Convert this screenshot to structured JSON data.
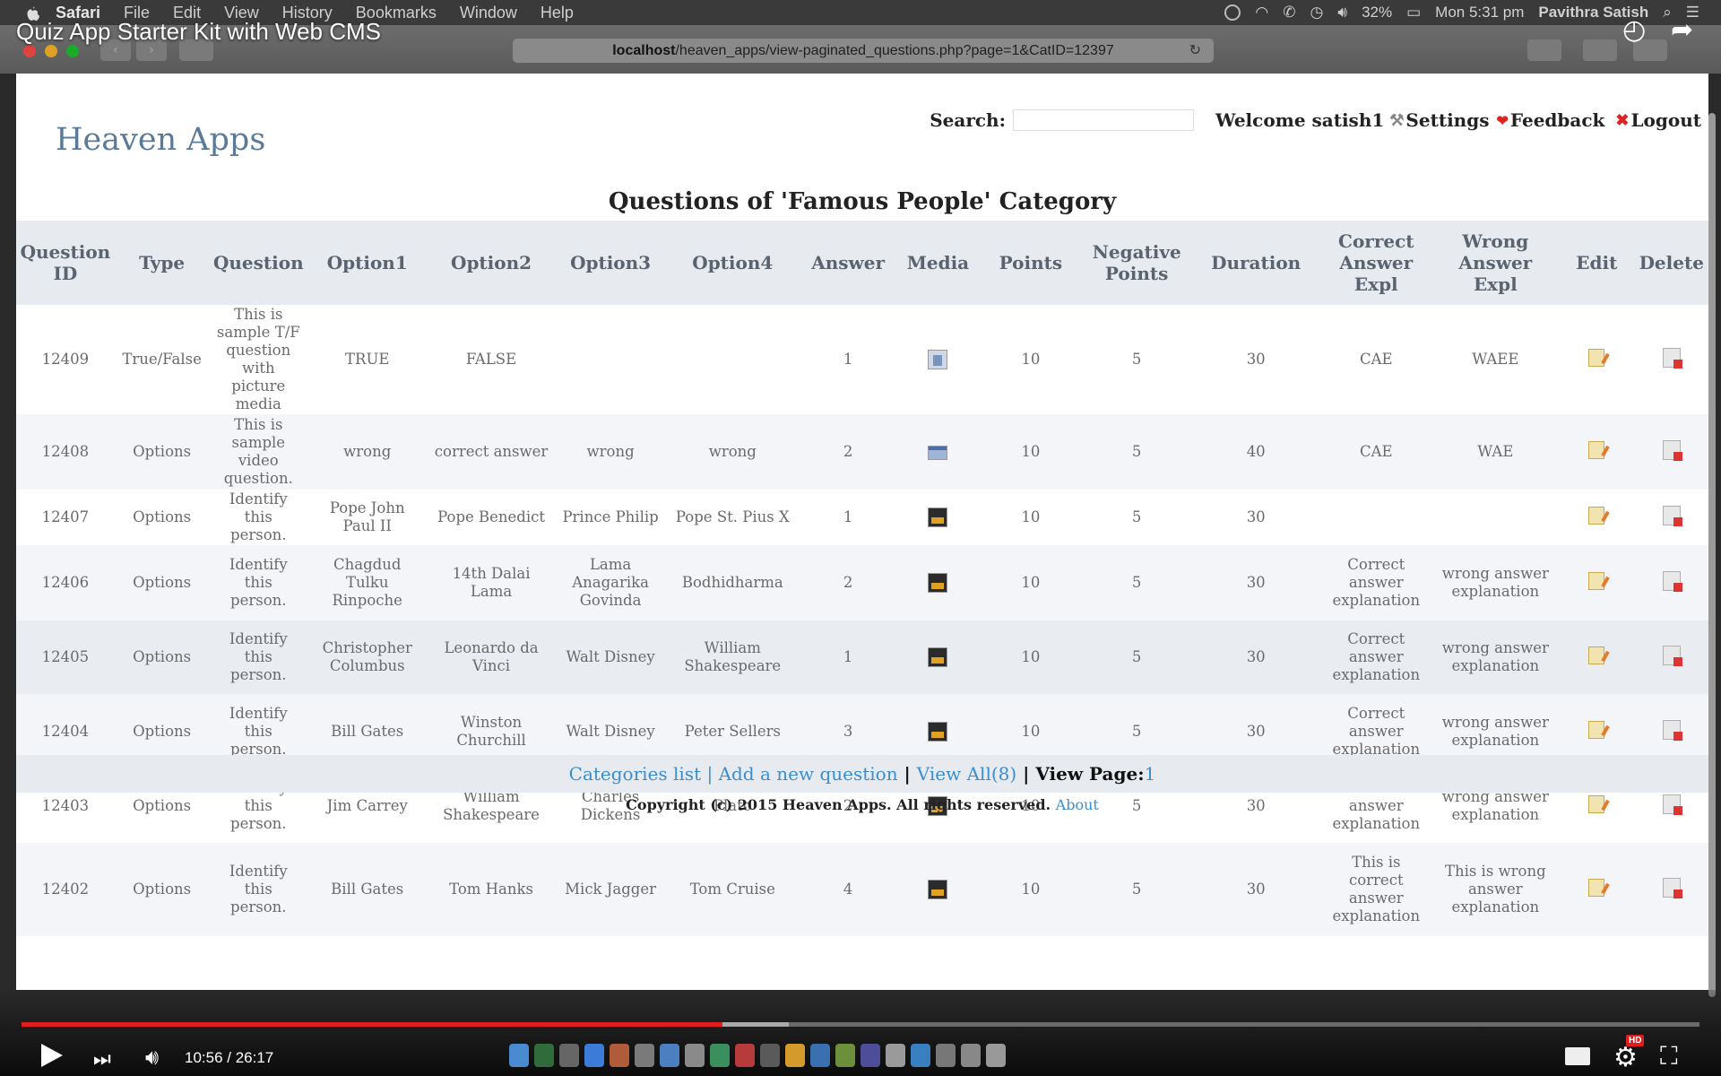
{
  "menubar": {
    "app": "Safari",
    "items": [
      "File",
      "Edit",
      "View",
      "History",
      "Bookmarks",
      "Window",
      "Help"
    ],
    "battery": "32%",
    "clock": "Mon 5:31 pm",
    "user": "Pavithra Satish"
  },
  "browser": {
    "url_host": "localhost",
    "url_path": "/heaven_apps/view-paginated_questions.php?page=1&CatID=12397"
  },
  "video": {
    "title": "Quiz App Starter Kit with Web CMS",
    "time": "10:56 / 26:17",
    "played_fraction": 0.418,
    "buffered_fraction": 0.457,
    "hd": "HD"
  },
  "header": {
    "brand": "Heaven Apps",
    "search_label": "Search:",
    "search_value": "",
    "welcome": "Welcome satish1",
    "settings": "Settings",
    "feedback": "Feedback",
    "logout": "Logout"
  },
  "page_title": "Questions of 'Famous People' Category",
  "columns": [
    "Question ID",
    "Type",
    "Question",
    "Option1",
    "Option2",
    "Option3",
    "Option4",
    "Answer",
    "Media",
    "Points",
    "Negative Points",
    "Duration",
    "Correct Answer Expl",
    "Wrong Answer Expl",
    "Edit",
    "Delete"
  ],
  "rows": [
    {
      "id": "12409",
      "type": "True/False",
      "question": "This is sample T/F question with picture media",
      "o1": "TRUE",
      "o2": "FALSE",
      "o3": "",
      "o4": "",
      "answer": "1",
      "media": "document-icon",
      "points": "10",
      "neg": "5",
      "duration": "30",
      "cae": "CAE",
      "wae": "WAEE"
    },
    {
      "id": "12408",
      "type": "Options",
      "question": "This is sample video question.",
      "o1": "wrong",
      "o2": "correct answer",
      "o3": "wrong",
      "o4": "wrong",
      "answer": "2",
      "media": "video-icon",
      "points": "10",
      "neg": "5",
      "duration": "40",
      "cae": "CAE",
      "wae": "WAE"
    },
    {
      "id": "12407",
      "type": "Options",
      "question": "Identify this person.",
      "o1": "Pope John Paul II",
      "o2": "Pope Benedict",
      "o3": "Prince Philip",
      "o4": "Pope St. Pius X",
      "answer": "1",
      "media": "image-icon",
      "points": "10",
      "neg": "5",
      "duration": "30",
      "cae": "",
      "wae": ""
    },
    {
      "id": "12406",
      "type": "Options",
      "question": "Identify this person.",
      "o1": "Chagdud Tulku Rinpoche",
      "o2": "14th Dalai Lama",
      "o3": "Lama Anagarika Govinda",
      "o4": "Bodhidharma",
      "answer": "2",
      "media": "image-icon",
      "points": "10",
      "neg": "5",
      "duration": "30",
      "cae": "Correct answer explanation",
      "wae": "wrong answer explanation"
    },
    {
      "id": "12405",
      "type": "Options",
      "question": "Identify this person.",
      "o1": "Christopher Columbus",
      "o2": "Leonardo da Vinci",
      "o3": "Walt Disney",
      "o4": "William Shakespeare",
      "answer": "1",
      "media": "image-icon",
      "points": "10",
      "neg": "5",
      "duration": "30",
      "cae": "Correct answer explanation",
      "wae": "wrong answer explanation"
    },
    {
      "id": "12404",
      "type": "Options",
      "question": "Identify this person.",
      "o1": "Bill Gates",
      "o2": "Winston Churchill",
      "o3": "Walt Disney",
      "o4": "Peter Sellers",
      "answer": "3",
      "media": "image-icon",
      "points": "10",
      "neg": "5",
      "duration": "30",
      "cae": "Correct answer explanation",
      "wae": "wrong answer explanation"
    },
    {
      "id": "12403",
      "type": "Options",
      "question": "Identify this person.",
      "o1": "Jim Carrey",
      "o2": "William Shakespeare",
      "o3": "Charles Dickens",
      "o4": "Plato",
      "answer": "2",
      "media": "image-icon",
      "points": "10",
      "neg": "5",
      "duration": "30",
      "cae": "Correct answer explanation",
      "wae": "wrong answer explanation"
    },
    {
      "id": "12402",
      "type": "Options",
      "question": "Identify this person.",
      "o1": "Bill Gates",
      "o2": "Tom Hanks",
      "o3": "Mick Jagger",
      "o4": "Tom Cruise",
      "answer": "4",
      "media": "image-icon",
      "points": "10",
      "neg": "5",
      "duration": "30",
      "cae": "This is correct answer explanation",
      "wae": "This is wrong answer explanation"
    }
  ],
  "footer": {
    "categories": "Categories list",
    "add": "Add a new question",
    "view_all": "View All(8)",
    "view_page_label": "View Page:",
    "page": "1",
    "sep": " | ",
    "copyright": "Copyright (c) 2015 Heaven Apps. All rights reserved.",
    "about": "About"
  }
}
